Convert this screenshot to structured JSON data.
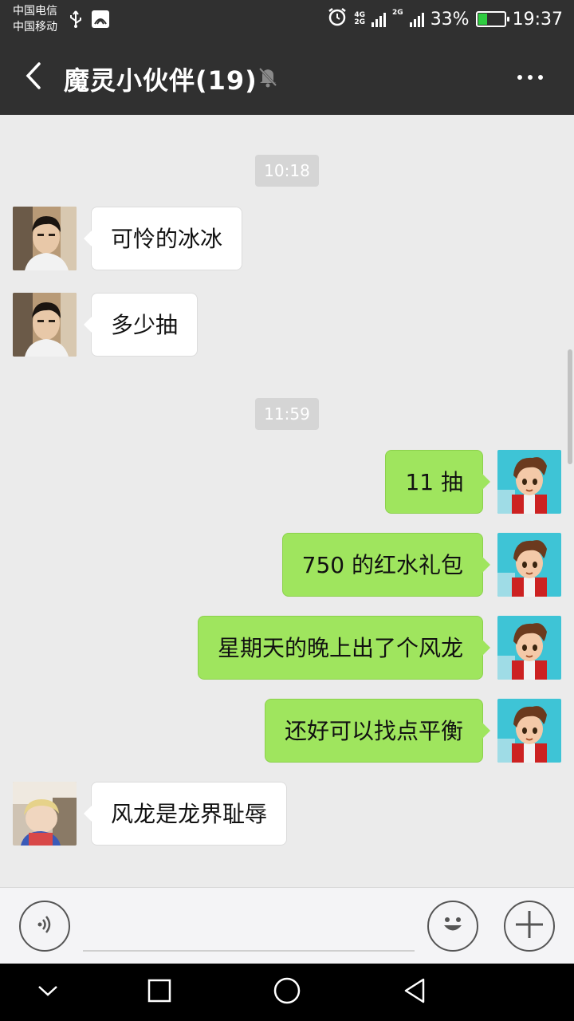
{
  "status_bar": {
    "carrier_1": "中国电信",
    "carrier_2": "中国移动",
    "net_tag_1": "4G",
    "net_tag_2": "2G",
    "net_tag_3": "2G",
    "battery_percent": "33%",
    "battery_level": 0.33,
    "time": "19:37"
  },
  "header": {
    "title": "魔灵小伙伴(19)",
    "back_icon": "chevron-left-icon",
    "mute_icon": "bell-off-icon",
    "more_icon": "more-horizontal-icon"
  },
  "messages": {
    "ts_1": "10:18",
    "m1": "可怜的冰冰",
    "m2": "多少抽",
    "ts_2": "11:59",
    "m3": "11 抽",
    "m4": "750 的红水礼包",
    "m5": "星期天的晚上出了个风龙",
    "m6": "还好可以找点平衡",
    "m7": "风龙是龙界耻辱"
  },
  "input_bar": {
    "voice_icon": "voice-icon",
    "emoji_icon": "emoji-icon",
    "plus_icon": "plus-icon",
    "input_value": ""
  },
  "colors": {
    "header_bg": "#303030",
    "chat_bg": "#ebebeb",
    "sent_bubble": "#9fe55e",
    "received_bubble": "#ffffff"
  }
}
